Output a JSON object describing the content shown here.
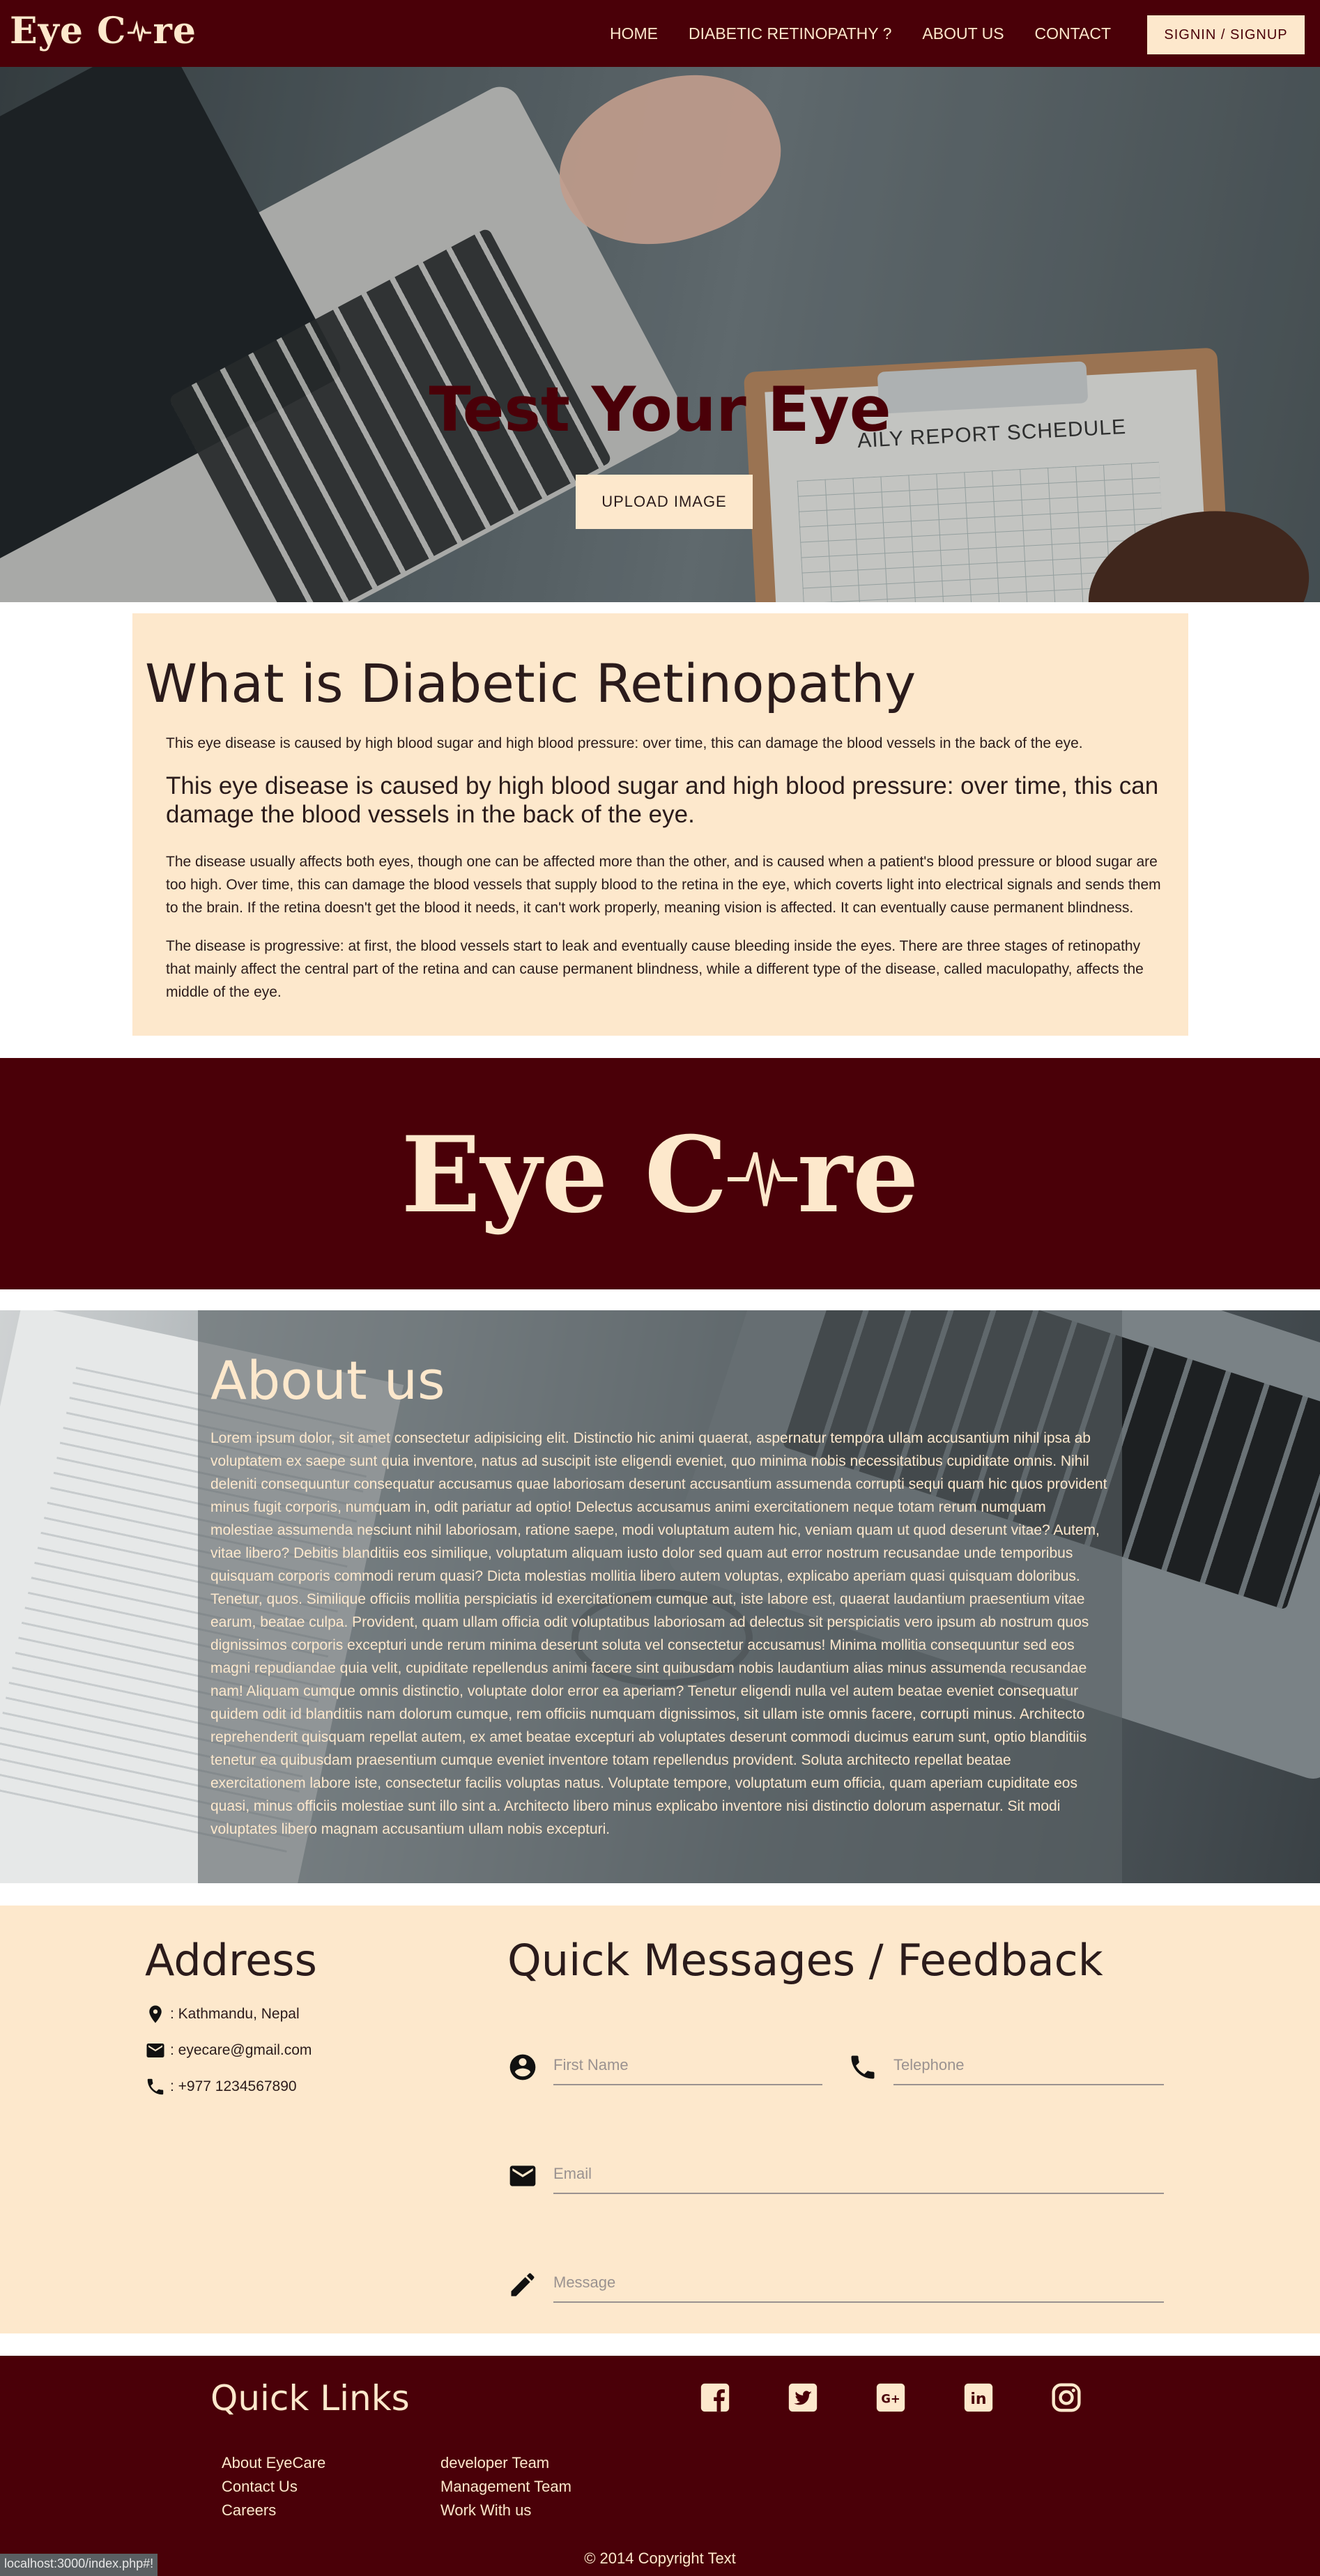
{
  "colors": {
    "primary": "#4a0008",
    "cream": "#fde8cc",
    "text": "#2b1b1b"
  },
  "navbar": {
    "brand_left": "Eye C",
    "brand_right": "re",
    "links": [
      "HOME",
      "DIABETIC RETINOPATHY ?",
      "ABOUT US",
      "CONTACT"
    ],
    "signin_label": "SIGNIN / SIGNUP"
  },
  "hero": {
    "paper_title": "AILY REPORT SCHEDULE",
    "title": "Test Your Eye",
    "upload_label": "UPLOAD IMAGE"
  },
  "info": {
    "heading": "What is Diabetic Retinopathy",
    "small": "This eye disease is caused by high blood sugar and high blood pressure: over time, this can damage the blood vessels in the back of the eye.",
    "large": "This eye disease is caused by high blood sugar and high blood pressure: over time, this can damage the blood vessels in the back of the eye.",
    "body1": "The disease usually affects both eyes, though one can be affected more than the other, and is caused when a patient's blood pressure or blood sugar are too high. Over time, this can damage the blood vessels that supply blood to the retina in the eye, which coverts light into electrical signals and sends them to the brain. If the retina doesn't get the blood it needs, it can't work properly, meaning vision is affected. It can eventually cause permanent blindness.",
    "body2": "The disease is progressive: at first, the blood vessels start to leak and eventually cause bleeding inside the eyes. There are three stages of retinopathy that mainly affect the central part of the retina and can cause permanent blindness, while a different type of the disease, called maculopathy, affects the middle of the eye."
  },
  "logo_band": {
    "left": "Eye C",
    "right": "re"
  },
  "about": {
    "heading": "About us",
    "text": "Lorem ipsum dolor, sit amet consectetur adipisicing elit. Distinctio hic animi quaerat, aspernatur tempora ullam accusantium nihil ipsa ab voluptatem ex saepe sunt quia inventore, natus ad suscipit iste eligendi eveniet, quo minima nobis necessitatibus cupiditate omnis. Nihil deleniti consequuntur consequatur accusamus quae laboriosam deserunt accusantium assumenda corrupti sequi quam hic quos provident minus fugit corporis, numquam in, odit pariatur ad optio! Delectus accusamus animi exercitationem neque totam rerum numquam molestiae assumenda nesciunt nihil laboriosam, ratione saepe, modi voluptatum autem hic, veniam quam ut quod deserunt vitae? Autem, vitae libero? Debitis blanditiis eos similique, voluptatum aliquam iusto dolor sed quam aut error nostrum recusandae unde temporibus quisquam corporis commodi rerum quasi? Dicta molestias mollitia libero autem voluptas, explicabo aperiam quasi quisquam doloribus. Tenetur, quos. Similique officiis mollitia perspiciatis id exercitationem cumque aut, iste labore est, quaerat laudantium praesentium vitae earum, beatae culpa. Provident, quam ullam officia odit voluptatibus laboriosam ad delectus sit perspiciatis vero ipsum ab nostrum quos dignissimos corporis excepturi unde rerum minima deserunt soluta vel consectetur accusamus! Minima mollitia consequuntur sed eos magni repudiandae quia velit, cupiditate repellendus animi facere sint quibusdam nobis laudantium alias minus assumenda recusandae nam! Aliquam cumque omnis distinctio, voluptate dolor error ea aperiam? Tenetur eligendi nulla vel autem beatae eveniet consequatur quidem odit id blanditiis nam dolorum cumque, rem officiis numquam dignissimos, sit ullam iste omnis facere, corrupti minus. Architecto reprehenderit quisquam repellat autem, ex amet beatae excepturi ab voluptates deserunt commodi ducimus earum sunt, optio blanditiis tenetur ea quibusdam praesentium cumque eveniet inventore totam repellendus provident. Soluta architecto repellat beatae exercitationem labore iste, consectetur facilis voluptas natus. Voluptate tempore, voluptatum eum officia, quam aperiam cupiditate eos quasi, minus officiis molestiae sunt illo sint a. Architecto libero minus explicabo inventore nisi distinctio dolorum aspernatur. Sit modi voluptates libero magnam accusantium ullam nobis excepturi."
  },
  "contact": {
    "address_heading": "Address",
    "location": ": Kathmandu, Nepal",
    "email": ": eyecare@gmail.com",
    "phone": ": +977 1234567890",
    "feedback_heading": "Quick Messages / Feedback",
    "first_name_placeholder": "First Name",
    "telephone_placeholder": "Telephone",
    "email_placeholder": "Email",
    "message_placeholder": "Message"
  },
  "footer": {
    "heading": "Quick Links",
    "col1": [
      "About EyeCare",
      "Contact Us",
      "Careers"
    ],
    "col2": [
      "developer Team",
      "Management Team",
      "Work With us"
    ],
    "social_icons": [
      "facebook-icon",
      "twitter-icon",
      "google-plus-icon",
      "linkedin-icon",
      "instagram-icon"
    ],
    "google_plus_text": "G+",
    "linkedin_text": "in",
    "copyright": "© 2014 Copyright Text"
  },
  "status_bar": {
    "url": "localhost:3000/index.php#!"
  }
}
